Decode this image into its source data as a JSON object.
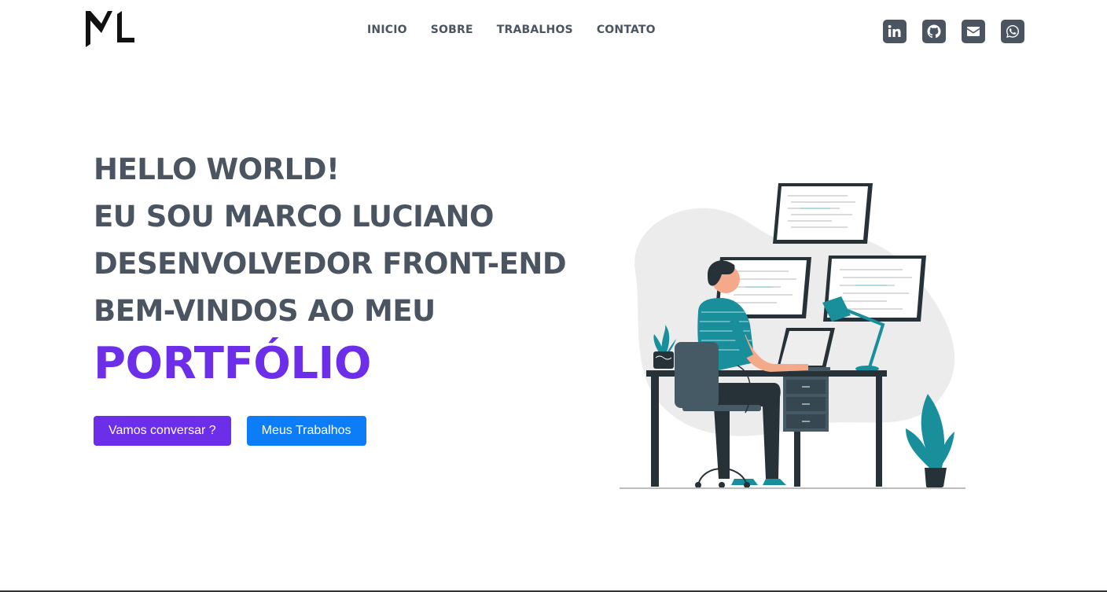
{
  "nav": {
    "logo_text": "ML",
    "links": [
      "INICIO",
      "SOBRE",
      "TRABALHOS",
      "CONTATO"
    ]
  },
  "socials": [
    {
      "icon": "linkedin-icon"
    },
    {
      "icon": "github-icon"
    },
    {
      "icon": "envelope-icon"
    },
    {
      "icon": "whatsapp-icon"
    }
  ],
  "hero": {
    "line1": "HELLO WORLD!",
    "line2": "EU SOU MARCO LUCIANO",
    "line3": "DESENVOLVEDOR FRONT-END",
    "line4": "BEM-VINDOS AO MEU",
    "highlight": "PORTFÓLIO",
    "primary_button": "Vamos conversar ?",
    "secondary_button": "Meus Trabalhos"
  },
  "colors": {
    "text": "#4a5561",
    "accent": "#6c2ee8",
    "button_blue": "#0d7cf7",
    "teal": "#1a8f9c"
  }
}
